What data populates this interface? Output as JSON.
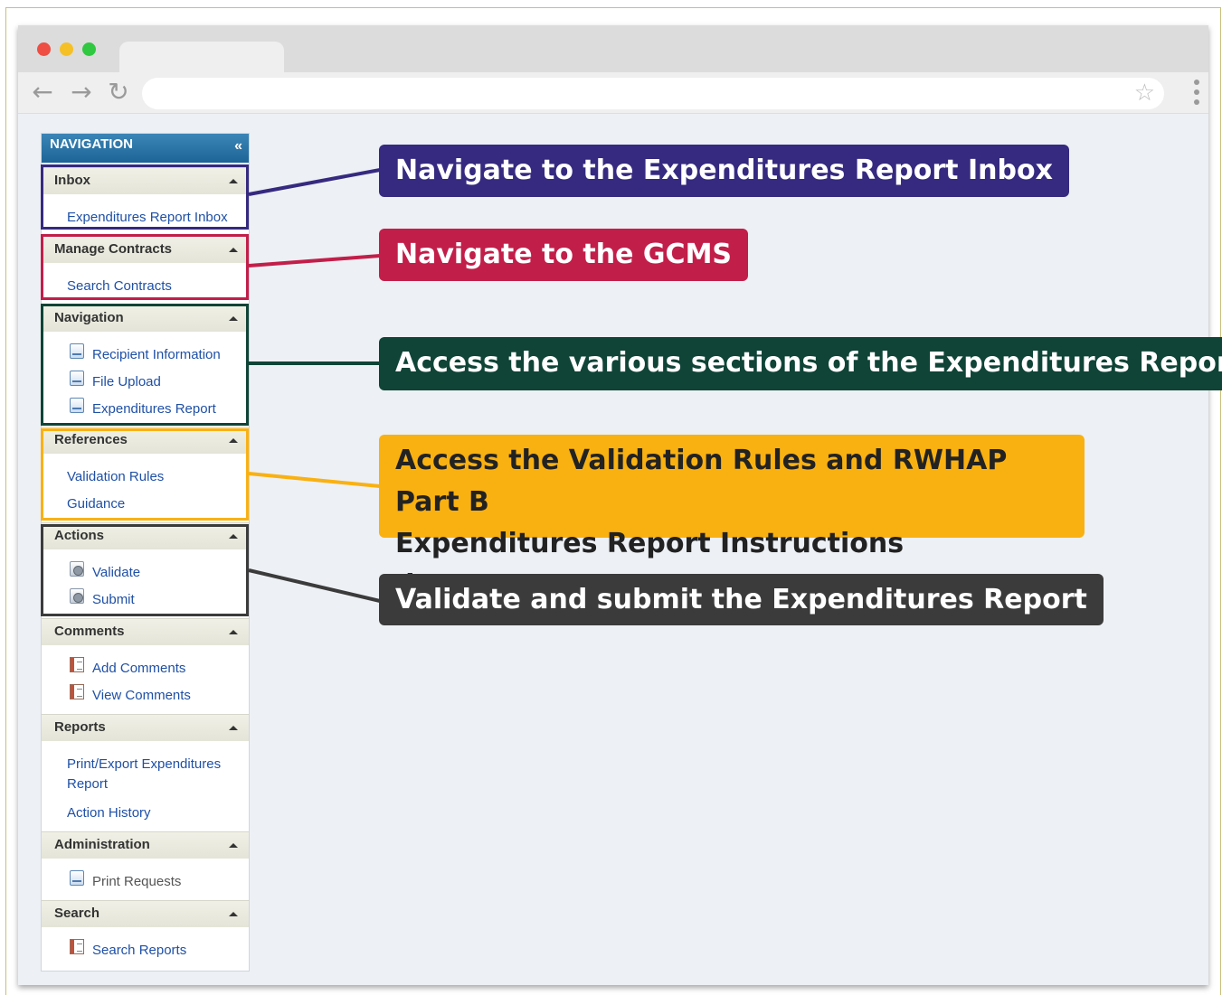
{
  "navigation": {
    "header": "NAVIGATION",
    "collapse_icon": "«",
    "sections": [
      {
        "title": "Inbox",
        "items": [
          {
            "label": "Expenditures Report Inbox",
            "icon": null
          }
        ]
      },
      {
        "title": "Manage Contracts",
        "items": [
          {
            "label": "Search Contracts",
            "icon": null
          }
        ]
      },
      {
        "title": "Navigation",
        "items": [
          {
            "label": "Recipient Information",
            "icon": "document-icon"
          },
          {
            "label": "File Upload",
            "icon": "document-icon"
          },
          {
            "label": "Expenditures Report",
            "icon": "document-icon"
          }
        ]
      },
      {
        "title": "References",
        "items": [
          {
            "label": "Validation Rules",
            "icon": null
          },
          {
            "label": "Guidance",
            "icon": null
          }
        ]
      },
      {
        "title": "Actions",
        "items": [
          {
            "label": "Validate",
            "icon": "gear-document-icon"
          },
          {
            "label": "Submit",
            "icon": "gear-document-icon"
          }
        ]
      },
      {
        "title": "Comments",
        "items": [
          {
            "label": "Add Comments",
            "icon": "notebook-icon"
          },
          {
            "label": "View Comments",
            "icon": "notebook-icon"
          }
        ]
      },
      {
        "title": "Reports",
        "items": [
          {
            "label": "Print/Export Expenditures Report",
            "line1": "Print/Export Expenditures",
            "line2": "Report",
            "icon": null
          },
          {
            "label": "Action History",
            "icon": null
          }
        ]
      },
      {
        "title": "Administration",
        "items": [
          {
            "label": "Print Requests",
            "icon": "document-icon"
          }
        ]
      },
      {
        "title": "Search",
        "items": [
          {
            "label": "Search Reports",
            "icon": "notebook-icon"
          }
        ]
      }
    ]
  },
  "callouts": [
    {
      "text": "Navigate to the Expenditures Report Inbox",
      "color": "#352a7f"
    },
    {
      "text": "Navigate to the GCMS",
      "color": "#c21e4a"
    },
    {
      "text": "Access the various sections of the Expenditures Report",
      "color": "#0f4436"
    },
    {
      "text_line1": "Access the Validation Rules and RWHAP Part B",
      "text_line2": "Expenditures Report Instructions documents",
      "color": "#f9b112",
      "text_color": "#222222"
    },
    {
      "text": "Validate and submit the Expenditures Report",
      "color": "#3b3b3b"
    }
  ],
  "browser": {
    "back_icon": "←",
    "forward_icon": "→",
    "reload_icon": "↻",
    "bookmark_icon": "☆"
  }
}
